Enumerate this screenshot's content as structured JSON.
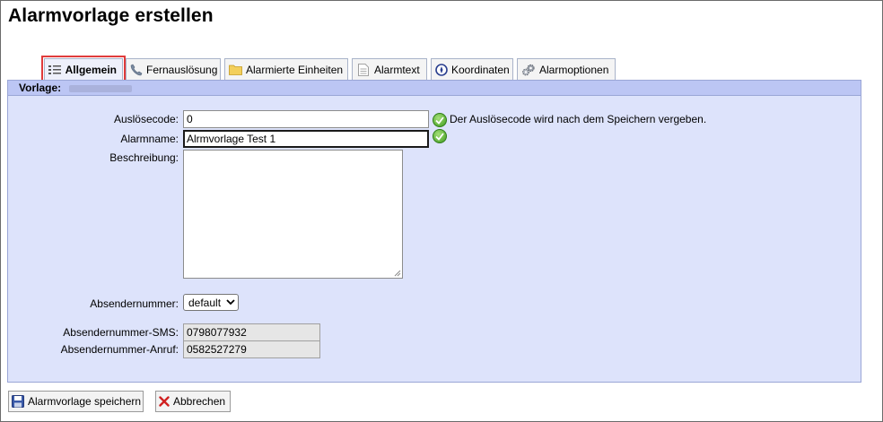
{
  "page": {
    "title": "Alarmvorlage erstellen"
  },
  "tabs": [
    {
      "label": "Allgemein",
      "icon": "list-icon",
      "active": true
    },
    {
      "label": "Fernauslösung",
      "icon": "phone-icon",
      "active": false
    },
    {
      "label": "Alarmierte Einheiten",
      "icon": "folder-icon",
      "active": false
    },
    {
      "label": "Alarmtext",
      "icon": "document-icon",
      "active": false
    },
    {
      "label": "Koordinaten",
      "icon": "compass-icon",
      "active": false
    },
    {
      "label": "Alarmoptionen",
      "icon": "gears-icon",
      "active": false
    }
  ],
  "panel": {
    "header_label": "Vorlage:"
  },
  "form": {
    "trigger_code": {
      "label": "Auslösecode:",
      "value": "0",
      "hint": "Der Auslösecode wird nach dem Speichern vergeben."
    },
    "alarm_name": {
      "label": "Alarmname:",
      "value": "Alrmvorlage Test 1"
    },
    "description": {
      "label": "Beschreibung:",
      "value": ""
    },
    "sender_number": {
      "label": "Absendernummer:",
      "selected": "default"
    },
    "sender_sms": {
      "label": "Absendernummer-SMS:",
      "value": "0798077932"
    },
    "sender_call": {
      "label": "Absendernummer-Anruf:",
      "value": "0582527279"
    }
  },
  "actions": {
    "save_label": "Alarmvorlage speichern",
    "cancel_label": "Abbrechen"
  },
  "colors": {
    "panel_bg": "#dde3fb",
    "panel_header_bg": "#bcc6f4",
    "active_tab_highlight": "#e03b3b",
    "valid_check": "#3d9b1d"
  }
}
